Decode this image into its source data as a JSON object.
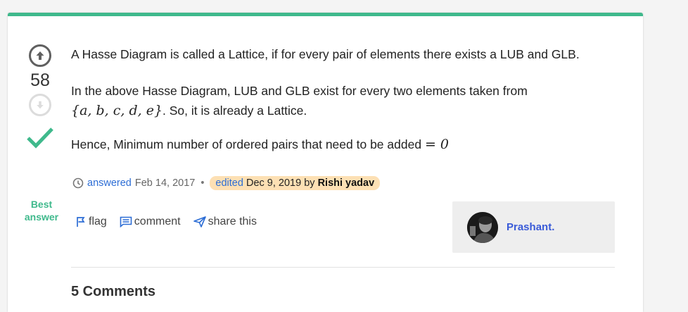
{
  "answer": {
    "vote_count": "58",
    "best_label_line1": "Best",
    "best_label_line2": "answer",
    "paragraph1": "A Hasse Diagram is called a Lattice, if for every pair of elements there exists a LUB and GLB.",
    "paragraph2_line1": "In the above Hasse Diagram, LUB and GLB exist for every two elements taken from",
    "paragraph2_set": "{a, b, c, d, e}",
    "paragraph2_tail": ". So, it is already a Lattice.",
    "paragraph3_text": "Hence, Minimum number of ordered pairs that need to be added ",
    "paragraph3_math": "= 0"
  },
  "meta": {
    "answered_label": "answered",
    "answered_date": "Feb 14, 2017",
    "separator": "•",
    "edited_label": "edited",
    "edited_date": "Dec 9, 2019",
    "by": "by",
    "editor": "Rishi yadav"
  },
  "actions": {
    "flag": "flag",
    "comment": "comment",
    "share": "share this"
  },
  "author": {
    "name": "Prashant."
  },
  "comments": {
    "title": "5 Comments"
  },
  "colors": {
    "accent_green": "#3fb98c",
    "link_blue": "#2c6dd5",
    "edited_bg": "#fde0b4"
  }
}
